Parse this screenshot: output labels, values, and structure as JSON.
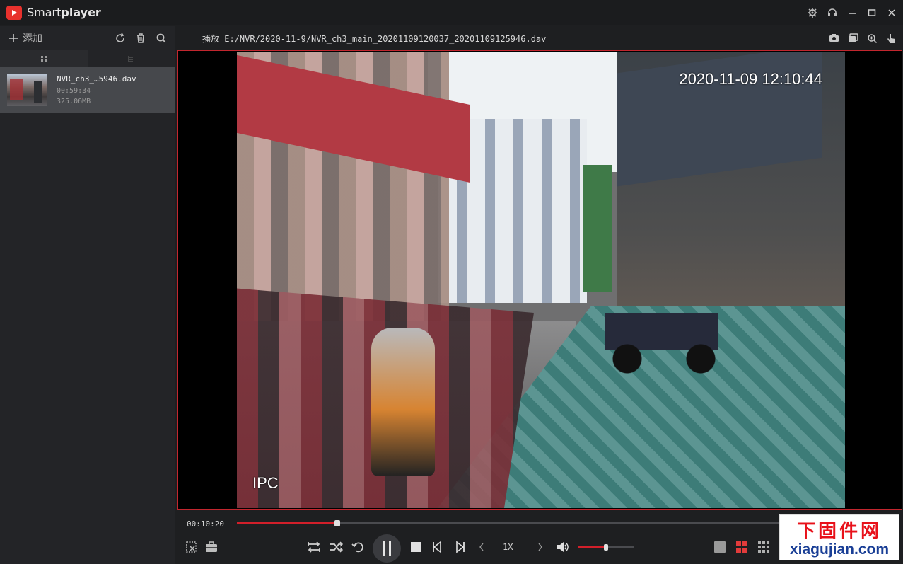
{
  "app": {
    "brand_light": "Smart",
    "brand_bold": "player"
  },
  "sidebar": {
    "add_label": "添加",
    "files": [
      {
        "name": "NVR_ch3_…5946.dav",
        "duration": "00:59:34",
        "size": "325.06MB"
      }
    ]
  },
  "player": {
    "play_path": "播放 E:/NVR/2020-11-9/NVR_ch3_main_20201109120037_20201109125946.dav",
    "osd_time": "2020-11-09 12:10:44",
    "osd_label": "IPC",
    "current_time": "00:10:20",
    "progress_fraction": 0.178,
    "speed": "1X",
    "volume_fraction": 0.5
  },
  "watermark": {
    "cn": "下固件网",
    "en": "xiagujian.com"
  },
  "colors": {
    "accent": "#d21f2a",
    "border_red": "#c2262e",
    "background": "#1e1f21"
  }
}
